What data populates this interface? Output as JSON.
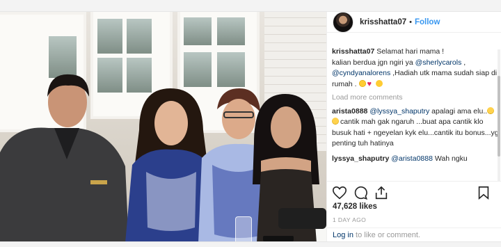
{
  "post": {
    "username": "krisshatta07",
    "separator": "•",
    "follow_label": "Follow",
    "caption": {
      "username": "krisshatta07",
      "line1": "Selamat hari mama !",
      "line2_prefix": "kalian berdua jgn ngiri ya ",
      "mention1": "@sherlycarols",
      "line2_suffix": " ,",
      "mention2": "@cyndyanalorens",
      "line3_suffix": " ,Hadiah utk mama sudah siap di rumah ."
    },
    "load_more_label": "Load more comments",
    "comments": [
      {
        "username": "arista0888",
        "mention": "@lyssya_shaputry",
        "text_a": " apalagi ama elu..",
        "text_b": "cantik mah gak ngaruh ...buat apa cantik klo busuk hati + ngeyelan kyk elu...cantik itu bonus...yg penting tuh hatinya"
      },
      {
        "username": "lyssya_shaputry",
        "mention": "@arista0888",
        "text_a": " Wah ngku"
      }
    ],
    "likes": "47,628 likes",
    "time_ago": "1 DAY AGO",
    "login": {
      "link": "Log in",
      "text": " to like or comment."
    }
  },
  "icons": {
    "heart": "heart-icon",
    "comment": "comment-icon",
    "share": "share-icon",
    "bookmark": "bookmark-icon"
  },
  "colors": {
    "link": "#003569",
    "follow": "#3897f0",
    "muted": "#999999",
    "text": "#262626"
  }
}
